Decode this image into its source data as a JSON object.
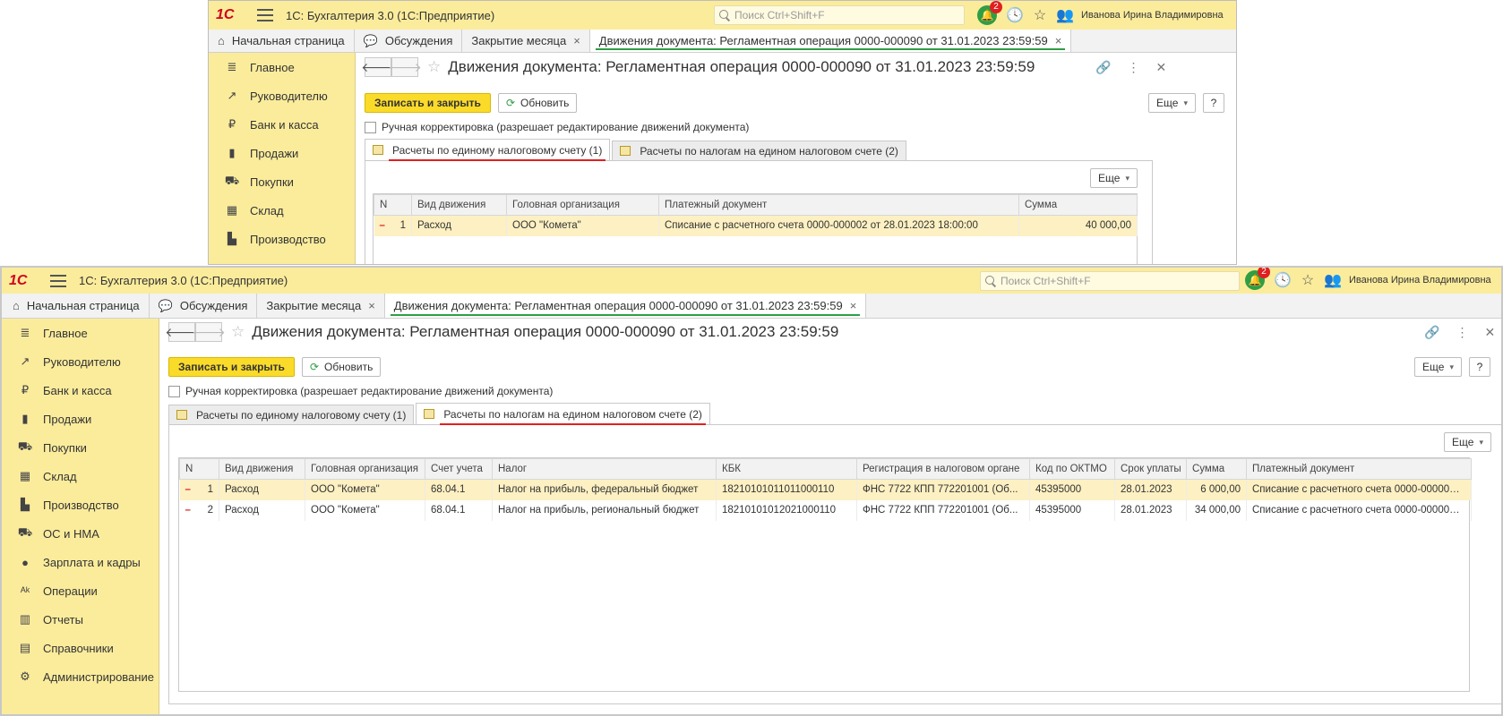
{
  "app": {
    "logo": "1С",
    "title": "1С: Бухгалтерия 3.0  (1С:Предприятие)",
    "search_placeholder": "Поиск Ctrl+Shift+F",
    "notif_count": "2",
    "user": "Иванова Ирина Владимировна"
  },
  "tabs": {
    "home": "Начальная страница",
    "discussions": "Обсуждения",
    "month_close": "Закрытие месяца",
    "doc_moves": "Движения документа: Регламентная операция 0000-000090 от 31.01.2023 23:59:59",
    "close_glyph": "×"
  },
  "sidebar": {
    "items": [
      {
        "label": "Главное",
        "icon": "≣"
      },
      {
        "label": "Руководителю",
        "icon": "↗"
      },
      {
        "label": "Банк и касса",
        "icon": "₽"
      },
      {
        "label": "Продажи",
        "icon": "▮"
      },
      {
        "label": "Покупки",
        "icon": "⛟"
      },
      {
        "label": "Склад",
        "icon": "▦"
      },
      {
        "label": "Производство",
        "icon": "▙"
      },
      {
        "label": "ОС и НМА",
        "icon": "⛟"
      },
      {
        "label": "Зарплата и кадры",
        "icon": "●"
      },
      {
        "label": "Операции",
        "icon": "ᴬᵏ"
      },
      {
        "label": "Отчеты",
        "icon": "▥"
      },
      {
        "label": "Справочники",
        "icon": "▤"
      },
      {
        "label": "Администрирование",
        "icon": "⚙"
      }
    ]
  },
  "document": {
    "title": "Движения документа: Регламентная операция 0000-000090 от 31.01.2023 23:59:59",
    "btn_save_close": "Записать и закрыть",
    "btn_refresh": "Обновить",
    "btn_more": "Еще",
    "btn_help": "?",
    "manual_edit": "Ручная корректировка (разрешает редактирование движений документа)",
    "tab1": "Расчеты по единому налоговому счету (1)",
    "tab2": "Расчеты по налогам на едином налоговом счете (2)"
  },
  "table1": {
    "headers": [
      "N",
      "Вид движения",
      "Головная организация",
      "Платежный документ",
      "Сумма"
    ],
    "rows": [
      {
        "mark": "–",
        "n": "1",
        "kind": "Расход",
        "org": "ООО \"Комета\"",
        "doc": "Списание с расчетного счета 0000-000002 от 28.01.2023 18:00:00",
        "sum": "40 000,00"
      }
    ]
  },
  "table2": {
    "headers": [
      "N",
      "Вид движения",
      "Головная организация",
      "Счет учета",
      "Налог",
      "КБК",
      "Регистрация в налоговом органе",
      "Код по ОКТМО",
      "Срок уплаты",
      "Сумма",
      "Платежный документ"
    ],
    "rows": [
      {
        "mark": "–",
        "n": "1",
        "kind": "Расход",
        "org": "ООО \"Комета\"",
        "acc": "68.04.1",
        "tax": "Налог на прибыль, федеральный бюджет",
        "kbk": "18210101011011000110",
        "reg": "ФНС 7722 КПП 772201001 (Об...",
        "oktmo": "45395000",
        "due": "28.01.2023",
        "sum": "6 000,00",
        "doc": "Списание с расчетного счета 0000-000002 ..."
      },
      {
        "mark": "–",
        "n": "2",
        "kind": "Расход",
        "org": "ООО \"Комета\"",
        "acc": "68.04.1",
        "tax": "Налог на прибыль, региональный бюджет",
        "kbk": "18210101012021000110",
        "reg": "ФНС 7722 КПП 772201001 (Об...",
        "oktmo": "45395000",
        "due": "28.01.2023",
        "sum": "34 000,00",
        "doc": "Списание с расчетного счета 0000-000002 ..."
      }
    ]
  },
  "colors": {
    "header_yellow": "#fbec9c",
    "primary_btn": "#fbdb2a",
    "active_underline_green": "#2f9e45",
    "annotation_red": "#e02020"
  }
}
